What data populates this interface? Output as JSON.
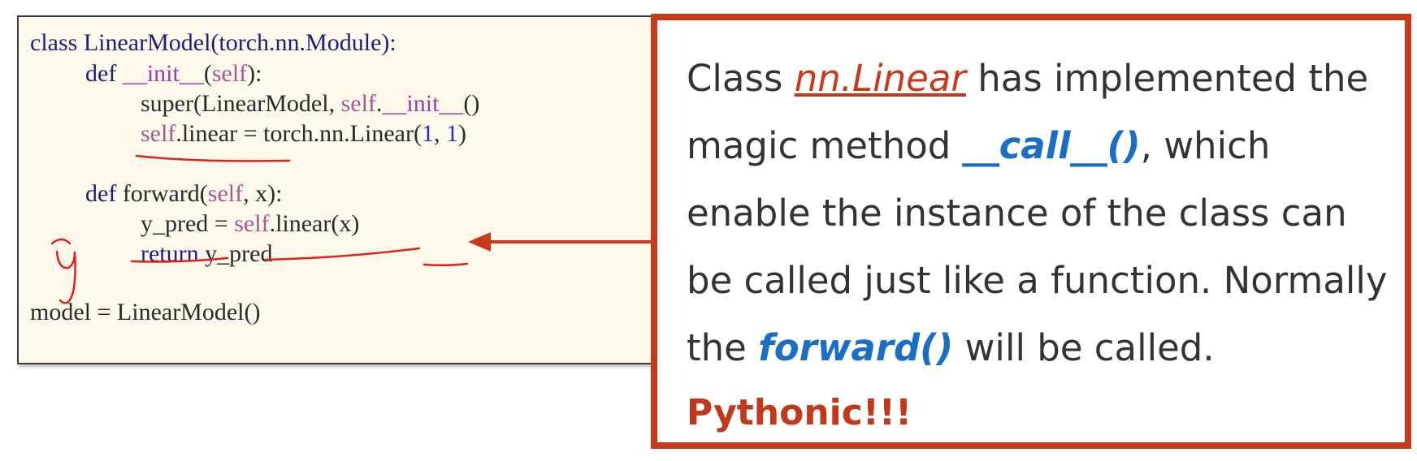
{
  "code": {
    "line1": {
      "a": "class LinearModel(torch.nn.Module):"
    },
    "line2": {
      "def": "def",
      "init": "__init__",
      "open": "(",
      "self": "self",
      "close": "):"
    },
    "line3": {
      "super": "super(LinearModel, ",
      "self": "self",
      "dot": ".",
      "init": "__init__",
      "parens": "()"
    },
    "line4": {
      "self": "self",
      "rest": ".linear = torch.nn.Linear(",
      "n1": "1",
      "comma": ", ",
      "n2": "1",
      "close": ")"
    },
    "line5": {
      "def": "def",
      "rest": " forward(",
      "self": "self",
      "tail": ", x):"
    },
    "line6": {
      "a": "y_pred = ",
      "self": "self",
      "rest": ".linear(x)"
    },
    "line7": {
      "ret": "return",
      "rest": " y_pred"
    },
    "line8": {
      "a": "model = LinearModel()"
    }
  },
  "callout": {
    "t1": "Class ",
    "link": "nn.Linear",
    "t2": " has implemented the magic method ",
    "call": "__call__()",
    "t3": ", which enable the instance of the class can be called just like a function. Normally the ",
    "forward": "forward()",
    "t4": " will be called.",
    "pythonic": "Pythonic!!!"
  },
  "colors": {
    "accent": "#c8391a",
    "blue": "#1a6fc4",
    "code_bg": "#fdf8ea"
  }
}
